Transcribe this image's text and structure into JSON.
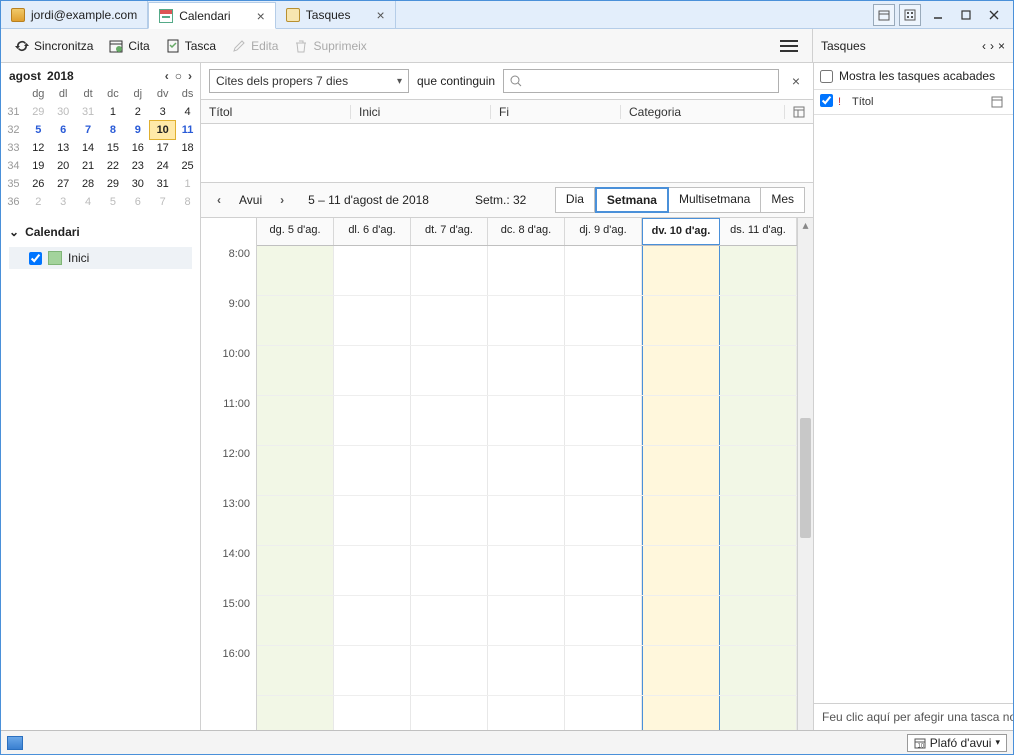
{
  "tabs": {
    "mail_label": "jordi@example.com",
    "calendar_label": "Calendari",
    "tasks_label": "Tasques"
  },
  "toolbar": {
    "sync": "Sincronitza",
    "event": "Cita",
    "task": "Tasca",
    "edit": "Edita",
    "delete": "Suprimeix"
  },
  "mini": {
    "month": "agost",
    "year": "2018",
    "dow": [
      "dg",
      "dl",
      "dt",
      "dc",
      "dj",
      "dv",
      "ds"
    ],
    "weeks": [
      {
        "wk": "31",
        "days": [
          {
            "d": "29",
            "dim": true
          },
          {
            "d": "30",
            "dim": true
          },
          {
            "d": "31",
            "dim": true
          },
          {
            "d": "1"
          },
          {
            "d": "2"
          },
          {
            "d": "3"
          },
          {
            "d": "4"
          }
        ]
      },
      {
        "wk": "32",
        "days": [
          {
            "d": "5",
            "cur": true
          },
          {
            "d": "6",
            "cur": true
          },
          {
            "d": "7",
            "cur": true
          },
          {
            "d": "8",
            "cur": true
          },
          {
            "d": "9",
            "cur": true
          },
          {
            "d": "10",
            "today": true
          },
          {
            "d": "11",
            "cur": true
          }
        ]
      },
      {
        "wk": "33",
        "days": [
          {
            "d": "12"
          },
          {
            "d": "13"
          },
          {
            "d": "14"
          },
          {
            "d": "15"
          },
          {
            "d": "16"
          },
          {
            "d": "17"
          },
          {
            "d": "18"
          }
        ]
      },
      {
        "wk": "34",
        "days": [
          {
            "d": "19"
          },
          {
            "d": "20"
          },
          {
            "d": "21"
          },
          {
            "d": "22"
          },
          {
            "d": "23"
          },
          {
            "d": "24"
          },
          {
            "d": "25"
          }
        ]
      },
      {
        "wk": "35",
        "days": [
          {
            "d": "26"
          },
          {
            "d": "27"
          },
          {
            "d": "28"
          },
          {
            "d": "29"
          },
          {
            "d": "30"
          },
          {
            "d": "31"
          },
          {
            "d": "1",
            "dim": true
          }
        ]
      },
      {
        "wk": "36",
        "days": [
          {
            "d": "2",
            "dim": true
          },
          {
            "d": "3",
            "dim": true
          },
          {
            "d": "4",
            "dim": true
          },
          {
            "d": "5",
            "dim": true
          },
          {
            "d": "6",
            "dim": true
          },
          {
            "d": "7",
            "dim": true
          },
          {
            "d": "8",
            "dim": true
          }
        ]
      }
    ]
  },
  "tree": {
    "header": "Calendari",
    "item": "Inici"
  },
  "filter": {
    "combo": "Cites dels propers 7 dies",
    "contain_label": "que continguin"
  },
  "cols": {
    "c1": "Títol",
    "c2": "Inici",
    "c3": "Fi",
    "c4": "Categoria"
  },
  "nav": {
    "today": "Avui",
    "range": "5 – 11 d'agost de 2018",
    "weeklabel": "Setm.: 32",
    "views": {
      "day": "Dia",
      "week": "Setmana",
      "multi": "Multisetmana",
      "month": "Mes"
    }
  },
  "dayheaders": [
    "dg. 5 d'ag.",
    "dl. 6 d'ag.",
    "dt. 7 d'ag.",
    "dc. 8 d'ag.",
    "dj. 9 d'ag.",
    "dv. 10 d'ag.",
    "ds. 11 d'ag."
  ],
  "times": [
    "8:00",
    "9:00",
    "10:00",
    "11:00",
    "12:00",
    "13:00",
    "14:00",
    "15:00",
    "16:00"
  ],
  "rightpanel": {
    "title": "Tasques",
    "show_done": "Mostra les tasques acabades",
    "col_title": "Títol",
    "add_hint": "Feu clic aquí per afegir una tasca no"
  },
  "status": {
    "todaypane": "Plafó d'avui"
  }
}
